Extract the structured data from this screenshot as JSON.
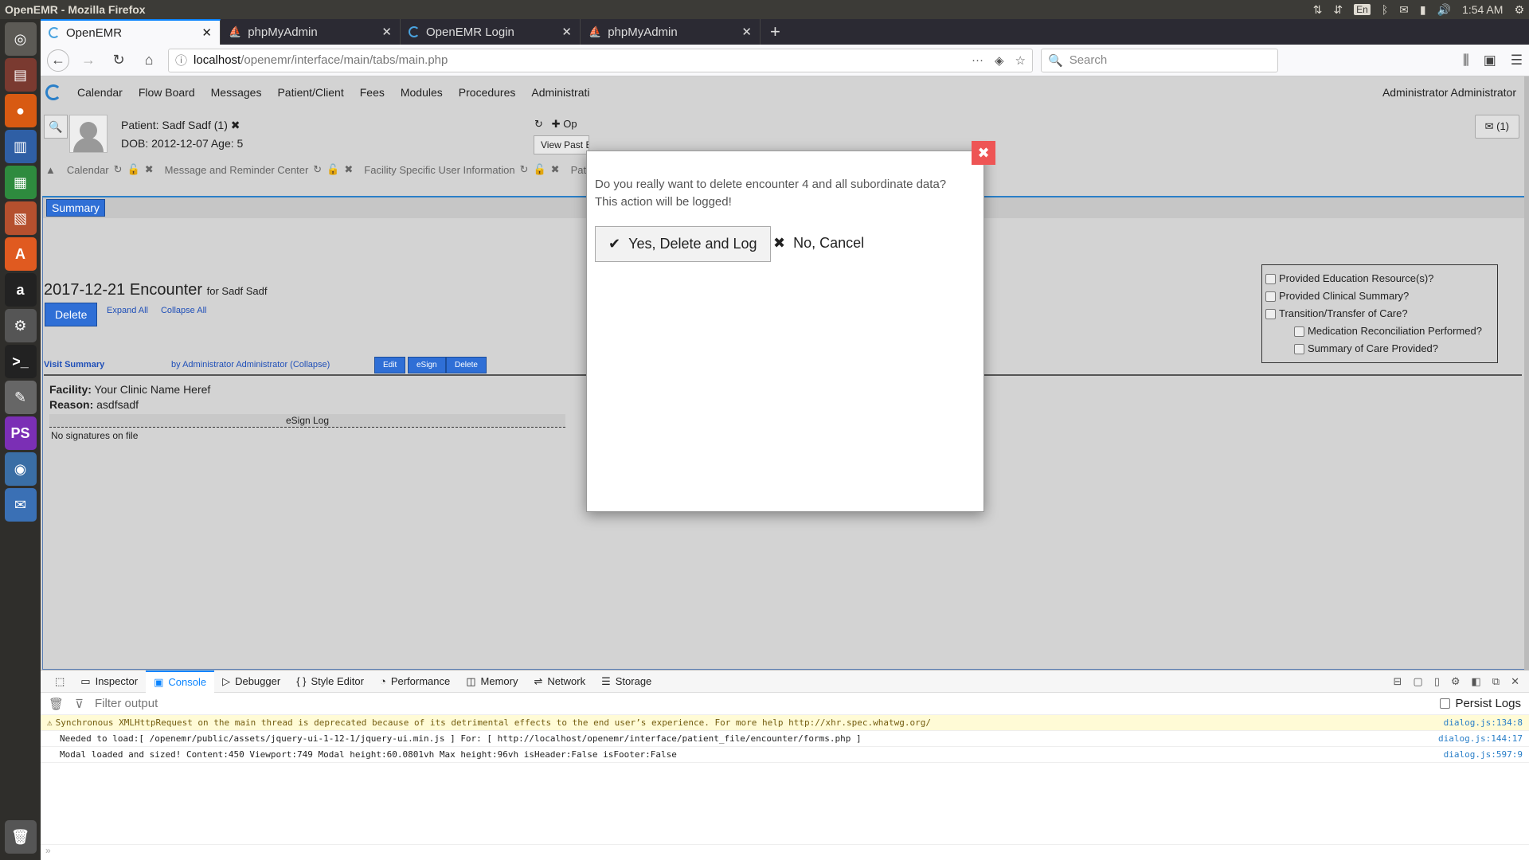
{
  "os": {
    "window_title": "OpenEMR - Mozilla Firefox",
    "kbd_layout": "En",
    "clock": "1:54 AM"
  },
  "browser": {
    "tabs": [
      {
        "label": "OpenEMR",
        "icon": "openemr-spinner-icon",
        "active": true
      },
      {
        "label": "phpMyAdmin",
        "icon": "phpmyadmin-icon",
        "active": false
      },
      {
        "label": "OpenEMR Login",
        "icon": "openemr-spinner-icon",
        "active": false
      },
      {
        "label": "phpMyAdmin",
        "icon": "phpmyadmin-icon",
        "active": false
      }
    ],
    "url_host": "localhost",
    "url_path": "/openemr/interface/main/tabs/main.php",
    "search_placeholder": "Search"
  },
  "emr": {
    "menu": [
      "Calendar",
      "Flow Board",
      "Messages",
      "Patient/Client",
      "Fees",
      "Modules",
      "Procedures",
      "Administrati"
    ],
    "user": "Administrator Administrator",
    "patient_label": "Patient: Sadf Sadf (1)",
    "dob_label": "DOB: 2012-12-07 Age: 5",
    "ops_label": "Op",
    "view_past": "View Past E",
    "messages_badge": "(1)",
    "tabs": [
      "Calendar",
      "Message and Reminder Center",
      "Facility Specific User Information",
      "Pati"
    ],
    "subtab": "Summary",
    "encounter_title": "2017-12-21 Encounter",
    "encounter_for": "for Sadf Sadf",
    "delete_label": "Delete",
    "expand_all": "Expand All",
    "collapse_all": "Collapse All",
    "visit_summary": "Visit Summary",
    "visit_by": "by Administrator Administrator (Collapse)",
    "mini_buttons": [
      "Edit",
      "eSign",
      "Delete"
    ],
    "facility_label": "Facility:",
    "facility_value": "Your Clinic Name Heref",
    "reason_label": "Reason:",
    "reason_value": "asdfsadf",
    "esign_log": "eSign Log",
    "no_signatures": "No signatures on file",
    "care_questions": [
      "Provided Education Resource(s)?",
      "Provided Clinical Summary?",
      "Transition/Transfer of Care?",
      "Medication Reconciliation Performed?",
      "Summary of Care Provided?"
    ]
  },
  "modal": {
    "message": "Do you really want to delete encounter 4 and all subordinate data? This action will be logged!",
    "yes_label": "Yes, Delete and Log",
    "no_label": "No, Cancel"
  },
  "devtools": {
    "tabs": [
      "Inspector",
      "Console",
      "Debugger",
      "Style Editor",
      "Performance",
      "Memory",
      "Network",
      "Storage"
    ],
    "active_tab": "Console",
    "filter_placeholder": "Filter output",
    "persist_logs": "Persist Logs",
    "logs": [
      {
        "level": "warn",
        "message": "Synchronous XMLHttpRequest on the main thread is deprecated because of its detrimental effects to the end user’s experience. For more help http://xhr.spec.whatwg.org/",
        "source": "dialog.js:134:8"
      },
      {
        "level": "log",
        "message": "Needed to load:[ /openemr/public/assets/jquery-ui-1-12-1/jquery-ui.min.js ] For: [ http://localhost/openemr/interface/patient_file/encounter/forms.php ]",
        "source": "dialog.js:144:17"
      },
      {
        "level": "log",
        "message": "Modal loaded and sized! Content:450 Viewport:749 Modal height:60.0801vh Max height:96vh isHeader:False  isFooter:False",
        "source": "dialog.js:597:9"
      }
    ]
  },
  "colors": {
    "accent_blue": "#2f6fd6",
    "link_blue": "#1f4fb8",
    "close_red": "#ee5555",
    "page_gray": "#d3d3d3"
  }
}
